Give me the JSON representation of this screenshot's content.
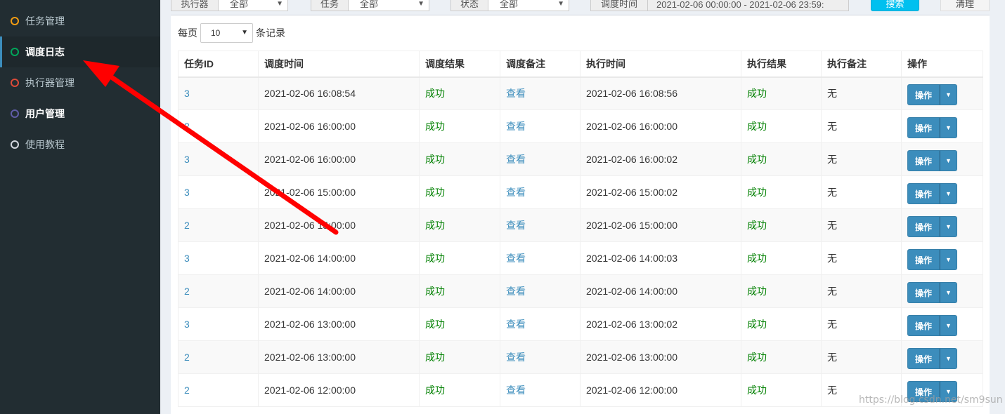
{
  "sidebar": {
    "items": [
      {
        "label": "任务管理",
        "color": "#f39c12"
      },
      {
        "label": "调度日志",
        "color": "#00a65a"
      },
      {
        "label": "执行器管理",
        "color": "#dd4b39"
      },
      {
        "label": "用户管理",
        "color": "#605ca8"
      },
      {
        "label": "使用教程",
        "color": "#d2d6de"
      }
    ]
  },
  "filters": {
    "executor_label": "执行器",
    "executor_value": "全部",
    "job_label": "任务",
    "job_value": "全部",
    "status_label": "状态",
    "status_value": "全部",
    "time_label": "调度时间",
    "time_value": "2021-02-06 00:00:00 - 2021-02-06 23:59:",
    "search_label": "搜索",
    "clear_label": "清理"
  },
  "pagesize": {
    "prefix": "每页",
    "value": "10",
    "suffix": "条记录"
  },
  "table": {
    "headers": [
      "任务ID",
      "调度时间",
      "调度结果",
      "调度备注",
      "执行时间",
      "执行结果",
      "执行备注",
      "操作"
    ],
    "rows": [
      {
        "id": "3",
        "trigger_time": "2021-02-06 16:08:54",
        "trigger_result": "成功",
        "trigger_msg": "查看",
        "handle_time": "2021-02-06 16:08:56",
        "handle_result": "成功",
        "handle_msg": "无",
        "op": "操作"
      },
      {
        "id": "2",
        "trigger_time": "2021-02-06 16:00:00",
        "trigger_result": "成功",
        "trigger_msg": "查看",
        "handle_time": "2021-02-06 16:00:00",
        "handle_result": "成功",
        "handle_msg": "无",
        "op": "操作"
      },
      {
        "id": "3",
        "trigger_time": "2021-02-06 16:00:00",
        "trigger_result": "成功",
        "trigger_msg": "查看",
        "handle_time": "2021-02-06 16:00:02",
        "handle_result": "成功",
        "handle_msg": "无",
        "op": "操作"
      },
      {
        "id": "3",
        "trigger_time": "2021-02-06 15:00:00",
        "trigger_result": "成功",
        "trigger_msg": "查看",
        "handle_time": "2021-02-06 15:00:02",
        "handle_result": "成功",
        "handle_msg": "无",
        "op": "操作"
      },
      {
        "id": "2",
        "trigger_time": "2021-02-06 15:00:00",
        "trigger_result": "成功",
        "trigger_msg": "查看",
        "handle_time": "2021-02-06 15:00:00",
        "handle_result": "成功",
        "handle_msg": "无",
        "op": "操作"
      },
      {
        "id": "3",
        "trigger_time": "2021-02-06 14:00:00",
        "trigger_result": "成功",
        "trigger_msg": "查看",
        "handle_time": "2021-02-06 14:00:03",
        "handle_result": "成功",
        "handle_msg": "无",
        "op": "操作"
      },
      {
        "id": "2",
        "trigger_time": "2021-02-06 14:00:00",
        "trigger_result": "成功",
        "trigger_msg": "查看",
        "handle_time": "2021-02-06 14:00:00",
        "handle_result": "成功",
        "handle_msg": "无",
        "op": "操作"
      },
      {
        "id": "3",
        "trigger_time": "2021-02-06 13:00:00",
        "trigger_result": "成功",
        "trigger_msg": "查看",
        "handle_time": "2021-02-06 13:00:02",
        "handle_result": "成功",
        "handle_msg": "无",
        "op": "操作"
      },
      {
        "id": "2",
        "trigger_time": "2021-02-06 13:00:00",
        "trigger_result": "成功",
        "trigger_msg": "查看",
        "handle_time": "2021-02-06 13:00:00",
        "handle_result": "成功",
        "handle_msg": "无",
        "op": "操作"
      },
      {
        "id": "2",
        "trigger_time": "2021-02-06 12:00:00",
        "trigger_result": "成功",
        "trigger_msg": "查看",
        "handle_time": "2021-02-06 12:00:00",
        "handle_result": "成功",
        "handle_msg": "无",
        "op": "操作"
      }
    ]
  },
  "watermark": "https://blog.csdn.net/sm9sun",
  "colors": {
    "sidebar_bg": "#222d32",
    "link": "#3c8dbc",
    "success": "#008000",
    "annotation_arrow": "#ff0000"
  }
}
